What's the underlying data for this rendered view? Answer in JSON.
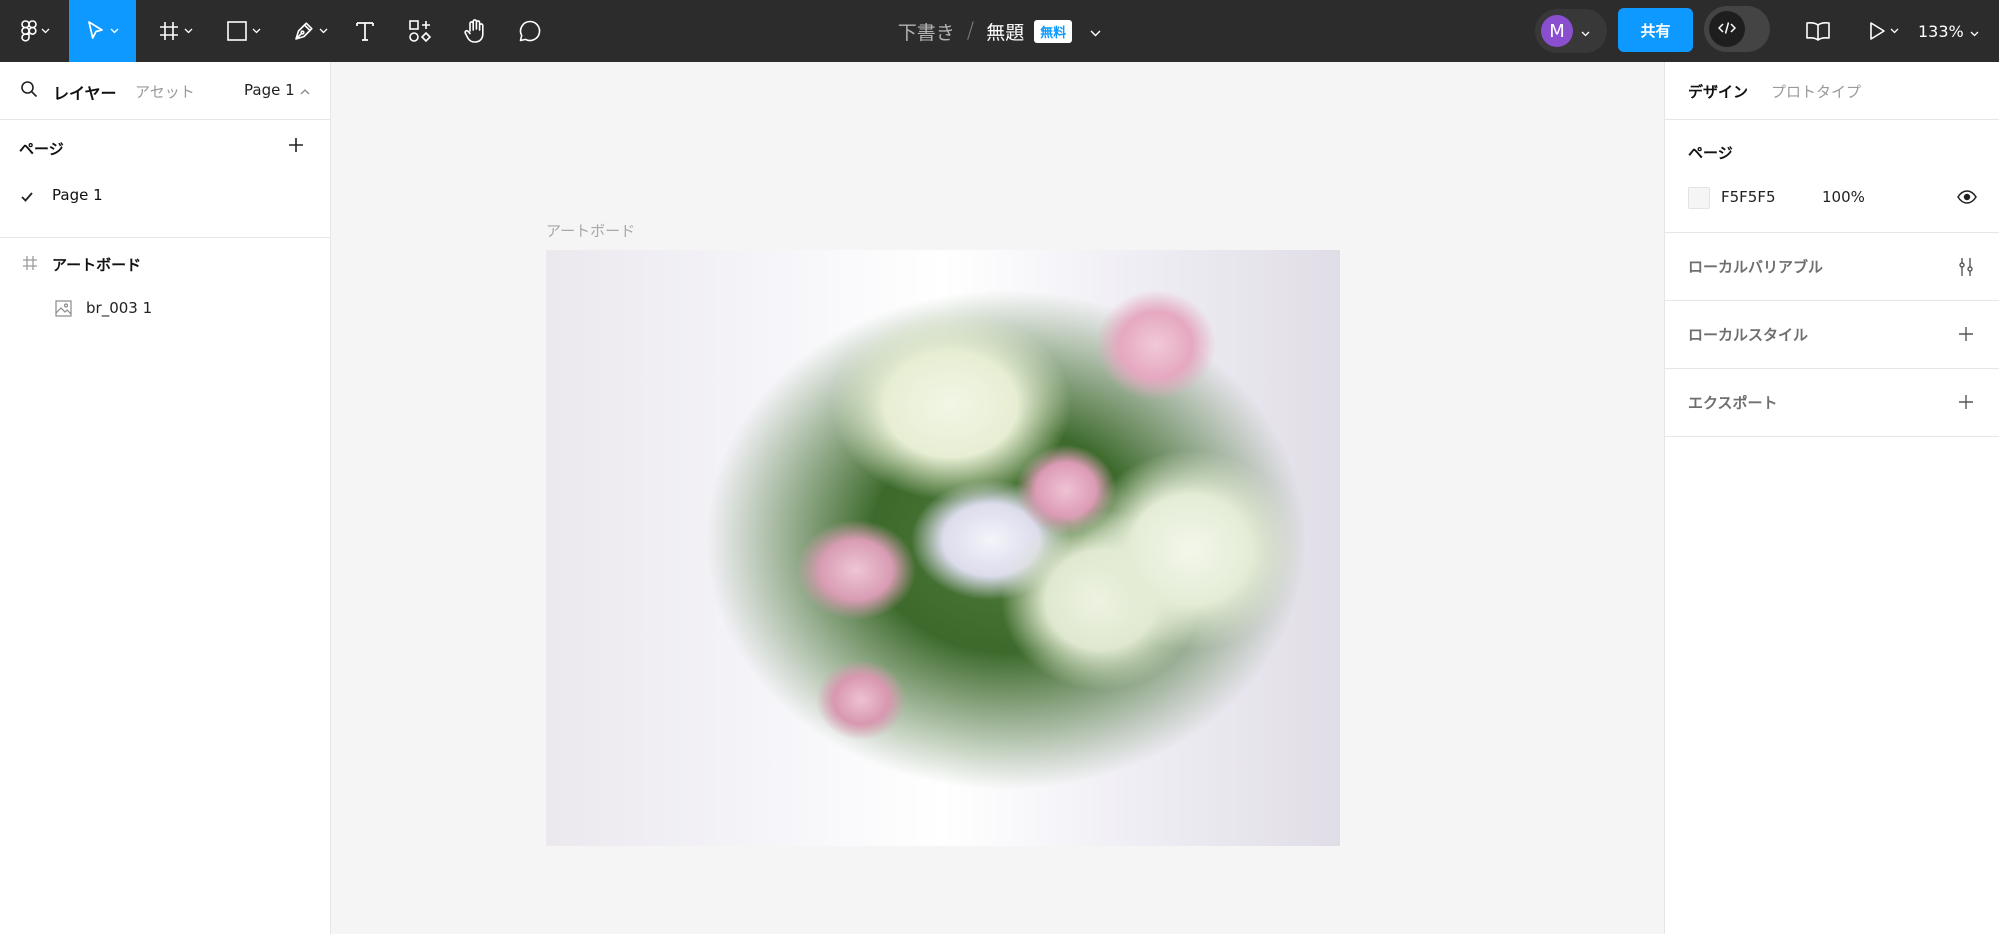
{
  "toolbar": {
    "tools": [
      {
        "name": "main-menu",
        "icon": "figma-logo-icon"
      },
      {
        "name": "move-tool",
        "icon": "cursor-arrow-icon",
        "active": true
      },
      {
        "name": "frame-tool",
        "icon": "hash-frame-icon"
      },
      {
        "name": "shape-tool",
        "icon": "square-icon"
      },
      {
        "name": "pen-tool",
        "icon": "pen-icon"
      },
      {
        "name": "text-tool",
        "icon": "text-t-icon"
      },
      {
        "name": "resources-tool",
        "icon": "components-icon"
      },
      {
        "name": "hand-tool",
        "icon": "hand-icon"
      },
      {
        "name": "comment-tool",
        "icon": "comment-bubble-icon"
      }
    ],
    "breadcrumb": {
      "draft": "下書き",
      "separator": "/",
      "file_name": "無題",
      "plan_badge": "無料"
    },
    "avatar_initial": "M",
    "share_label": "共有",
    "zoom_level": "133%",
    "accent_color": "#0d99ff",
    "avatar_color": "#8a4fcf"
  },
  "left_panel": {
    "tab_layers": "レイヤー",
    "tab_assets": "アセット",
    "current_page": "Page 1",
    "pages_title": "ページ",
    "pages": [
      {
        "label": "Page 1",
        "selected": true
      }
    ],
    "layers": [
      {
        "label": "アートボード",
        "type": "frame"
      },
      {
        "label": "br_003 1",
        "type": "image"
      }
    ]
  },
  "canvas": {
    "artboard_label": "アートボード",
    "background": "#F5F5F5"
  },
  "right_panel": {
    "tab_design": "デザイン",
    "tab_prototype": "プロトタイプ",
    "page_title": "ページ",
    "page_fill_hex": "F5F5F5",
    "page_fill_opacity": "100%",
    "local_variables": "ローカルバリアブル",
    "local_styles": "ローカルスタイル",
    "export": "エクスポート"
  }
}
